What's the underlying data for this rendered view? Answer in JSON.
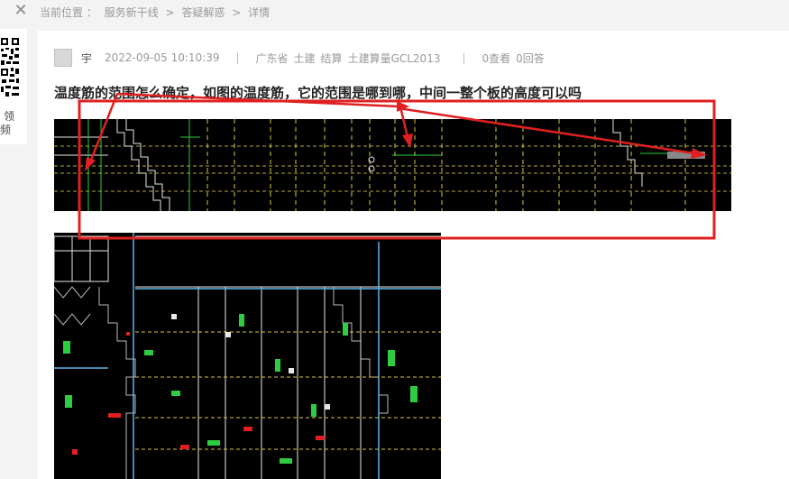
{
  "breadcrumb": {
    "prefix": "当前位置 ：",
    "items": [
      "服务新干线",
      ">",
      "答疑解惑",
      ">",
      "详情"
    ]
  },
  "sidebar": {
    "text_line1": "领",
    "text_line2": "频"
  },
  "post": {
    "author": "宇",
    "datetime": "2022-09-05 10:10:39",
    "separator": "|",
    "tags": [
      "广东省",
      "土建",
      "结算",
      "土建算量GCL2013"
    ],
    "views": "0查看",
    "answers": "0回答",
    "title": "温度筋的范围怎么确定，如图的温度筋，它的范围是哪到哪，中间一整个板的高度可以吗"
  },
  "colors": {
    "annotation": "#e02020",
    "cad_background": "#000000",
    "cad_green": "#2ecc40",
    "cad_yellow": "#d8c840",
    "cad_white": "#e8e8e8"
  }
}
